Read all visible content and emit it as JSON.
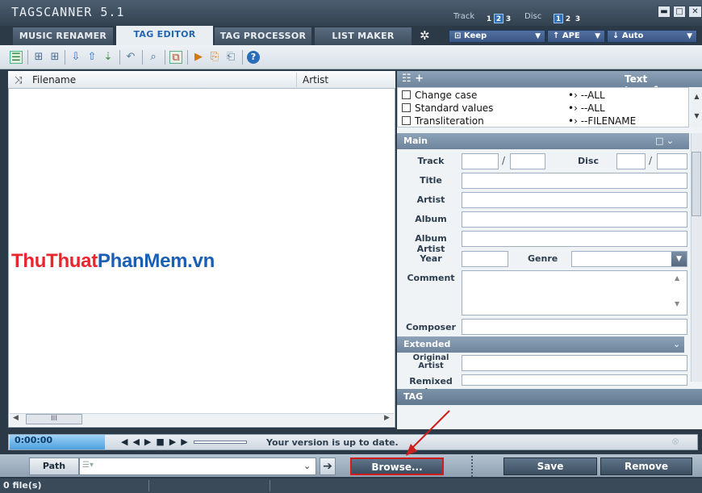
{
  "app": {
    "title": "TAGSCANNER 5.1"
  },
  "header": {
    "track_label": "Track",
    "track_numbers": [
      "1",
      "2",
      "3"
    ],
    "disc_label": "Disc",
    "disc_numbers": [
      "1",
      "2",
      "3"
    ],
    "keep_select": "Keep",
    "ape_select": "↑ APE",
    "auto_select": "↓ Auto"
  },
  "tabs": [
    {
      "label": "MUSIC RENAMER"
    },
    {
      "label": "TAG EDITOR",
      "active": true
    },
    {
      "label": "TAG PROCESSOR"
    },
    {
      "label": "LIST MAKER"
    }
  ],
  "filelist": {
    "columns": [
      "Filename",
      "Artist"
    ],
    "scroll_thumb": "III"
  },
  "watermark": {
    "part1": "ThuThuat",
    "part2": "PhanMem",
    "part3": ".vn"
  },
  "text_transform": {
    "header": "Text transform",
    "rows": [
      {
        "label": "Change case",
        "value": "--ALL"
      },
      {
        "label": "Standard values",
        "value": "--ALL"
      },
      {
        "label": "Transliteration",
        "value": "--FILENAME"
      }
    ]
  },
  "main_section": {
    "header": "Main",
    "fields": {
      "track": "Track",
      "disc": "Disc",
      "title": "Title",
      "artist": "Artist",
      "album": "Album",
      "album_artist": "Album Artist",
      "year": "Year",
      "genre": "Genre",
      "comment": "Comment",
      "composer": "Composer"
    },
    "slash": "/"
  },
  "extended_section": {
    "header": "Extended",
    "fields": {
      "original_artist_1": "Original",
      "original_artist_2": "Artist",
      "remixed_by": "Remixed by"
    }
  },
  "tag_section": {
    "header": "TAG"
  },
  "player": {
    "time": "0:00:00",
    "status": "Your version is up to date."
  },
  "pathbar": {
    "path_label": "Path",
    "browse": "Browse...",
    "save": "Save",
    "remove": "Remove"
  },
  "statusbar": {
    "files": "0 file(s)"
  },
  "colors": {
    "accent": "#2366b3",
    "watermark_red": "#e8262e",
    "watermark_blue": "#1a5fb4",
    "annotation_red": "#cc1f1f"
  }
}
